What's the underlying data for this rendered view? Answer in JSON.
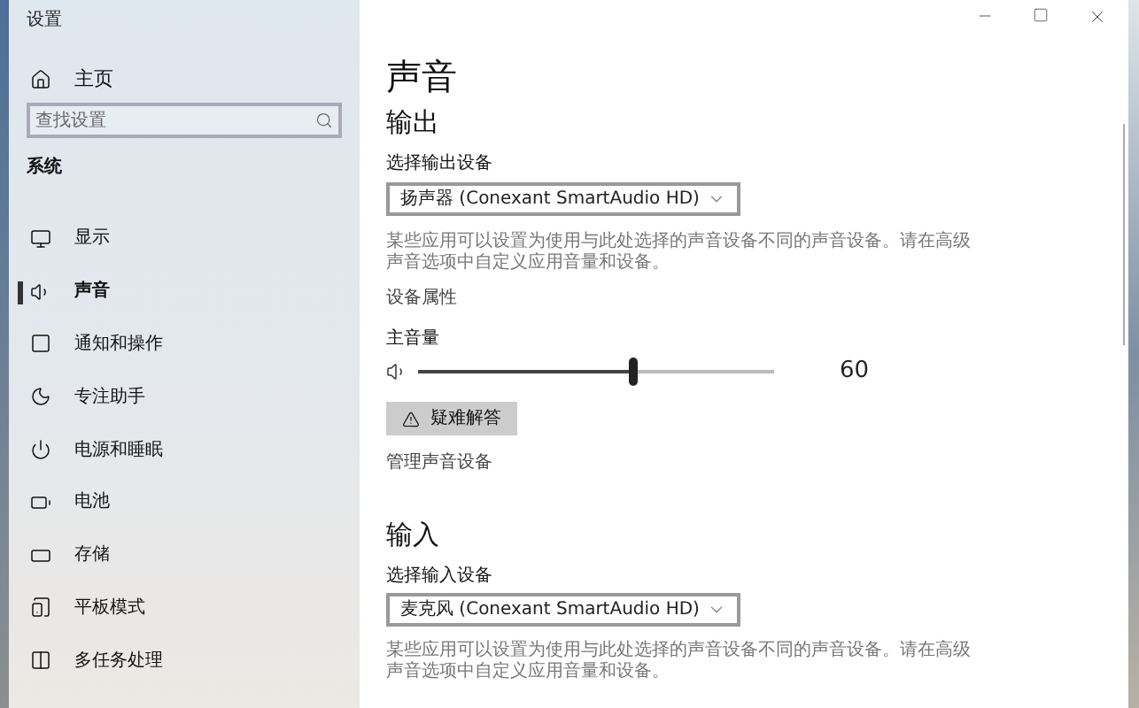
{
  "window": {
    "title": "设置"
  },
  "sidebar": {
    "home": "主页",
    "search": {
      "placeholder": "查找设置"
    },
    "section": "系统",
    "items": [
      {
        "label": "显示",
        "selected": false
      },
      {
        "label": "声音",
        "selected": true
      },
      {
        "label": "通知和操作",
        "selected": false
      },
      {
        "label": "专注助手",
        "selected": false
      },
      {
        "label": "电源和睡眠",
        "selected": false
      },
      {
        "label": "电池",
        "selected": false
      },
      {
        "label": "存储",
        "selected": false
      },
      {
        "label": "平板模式",
        "selected": false
      },
      {
        "label": "多任务处理",
        "selected": false
      }
    ]
  },
  "page": {
    "title": "声音",
    "output": {
      "heading": "输出",
      "device_label": "选择输出设备",
      "device": "扬声器 (Conexant SmartAudio HD)",
      "note": "某些应用可以设置为使用与此处选择的声音设备不同的声音设备。请在高级声音选项中自定义应用音量和设备。",
      "properties_link": "设备属性",
      "volume_label": "主音量",
      "volume": {
        "level": 0.6,
        "reading": "60"
      },
      "troubleshoot": "疑难解答",
      "manage_link": "管理声音设备"
    },
    "input": {
      "heading": "输入",
      "device_label": "选择输入设备",
      "device": "麦克风 (Conexant SmartAudio HD)",
      "note": "某些应用可以设置为使用与此处选择的声音设备不同的声音设备。请在高级声音选项中自定义应用音量和设备。"
    }
  }
}
